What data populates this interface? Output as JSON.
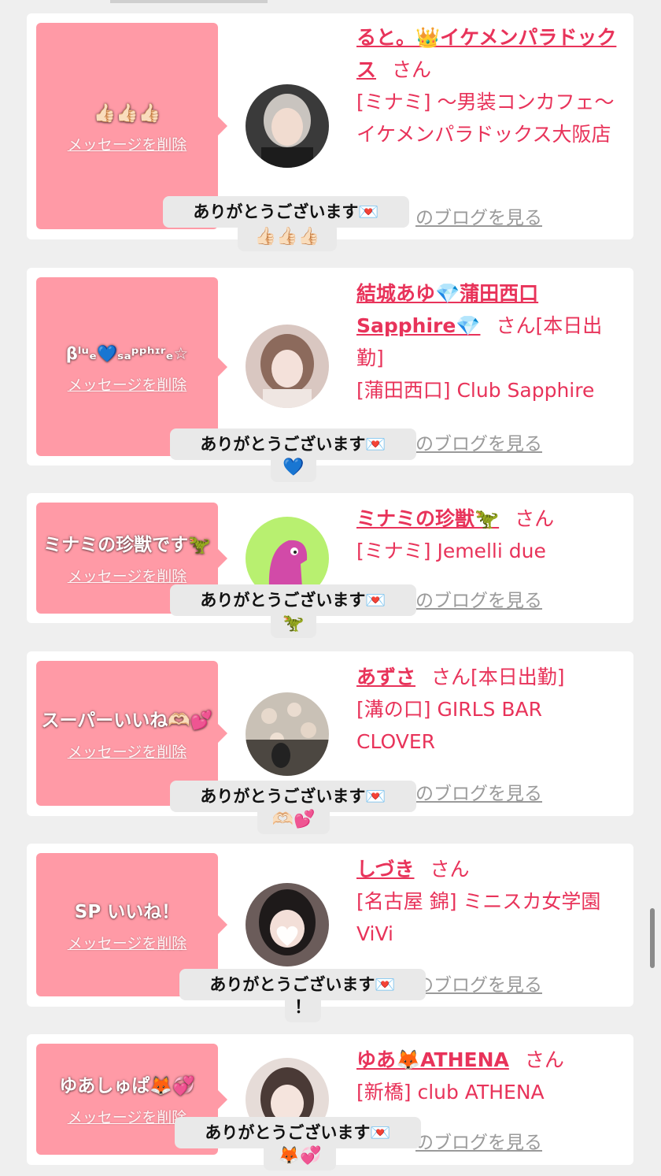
{
  "cards": [
    {
      "message": "👍🏻👍🏻👍🏻",
      "delete_label": "メッセージを削除",
      "name": "ると。👑イケメンパラドックス",
      "san": "さん",
      "shop": "[ミナミ] 〜男装コンカフェ〜イケメンパラドックス大阪店",
      "blog_label": "のブログを見る",
      "thanks_line1": "ありがとうございます💌",
      "thanks_line2": "👍🏻👍🏻👍🏻"
    },
    {
      "message": "βˡᵘₑ💙ₛₐᵖᵖʰᶦʳₑ☆",
      "delete_label": "メッセージを削除",
      "name": "結城あゆ💎蒲田西口Sapphire💎",
      "san": "さん[本日出勤]",
      "shop": "[蒲田西口] Club Sapphire",
      "blog_label": "のブログを見る",
      "thanks_line1": "ありがとうございます💌",
      "thanks_line2": "💙"
    },
    {
      "message": "ミナミの珍獣です🦖",
      "delete_label": "メッセージを削除",
      "name": "ミナミの珍獣🦖",
      "san": "さん",
      "shop": "[ミナミ] Jemelli due",
      "blog_label": "のブログを見る",
      "thanks_line1": "ありがとうございます💌",
      "thanks_line2": "🦖"
    },
    {
      "message": "スーパーいいね🫶🏻💕",
      "delete_label": "メッセージを削除",
      "name": "あずさ",
      "san": "さん[本日出勤]",
      "shop": "[溝の口] GIRLS BAR CLOVER",
      "blog_label": "のブログを見る",
      "thanks_line1": "ありがとうございます💌",
      "thanks_line2": "🫶🏻💕"
    },
    {
      "message": "SP いいね！",
      "delete_label": "メッセージを削除",
      "name": "しづき",
      "san": "さん",
      "shop": "[名古屋 錦] ミニスカ女学園ViVi",
      "blog_label": "のブログを見る",
      "thanks_line1": "ありがとうございます💌",
      "thanks_line2": "！"
    },
    {
      "message": "ゆあしゅぱ🦊💞",
      "delete_label": "メッセージを削除",
      "name": "ゆあ🦊ATHENA",
      "san": "さん",
      "shop": "[新橋] club ATHENA",
      "blog_label": "のブログを見る",
      "thanks_line1": "ありがとうございます💌",
      "thanks_line2": "🦊💞"
    }
  ],
  "colors": {
    "bubble": "#ff9aa6",
    "accent": "#e8335a",
    "background": "#efefef"
  }
}
